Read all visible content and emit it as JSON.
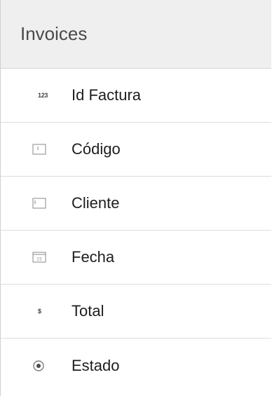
{
  "panel": {
    "title": "Invoices",
    "fields": [
      {
        "label": "Id Factura",
        "icon": "number-type-icon",
        "icon_text": "123"
      },
      {
        "label": "Código",
        "icon": "text-field-icon"
      },
      {
        "label": "Cliente",
        "icon": "text-area-icon"
      },
      {
        "label": "Fecha",
        "icon": "calendar-icon"
      },
      {
        "label": "Total",
        "icon": "currency-icon",
        "icon_text": "$"
      },
      {
        "label": "Estado",
        "icon": "radio-icon"
      }
    ]
  }
}
